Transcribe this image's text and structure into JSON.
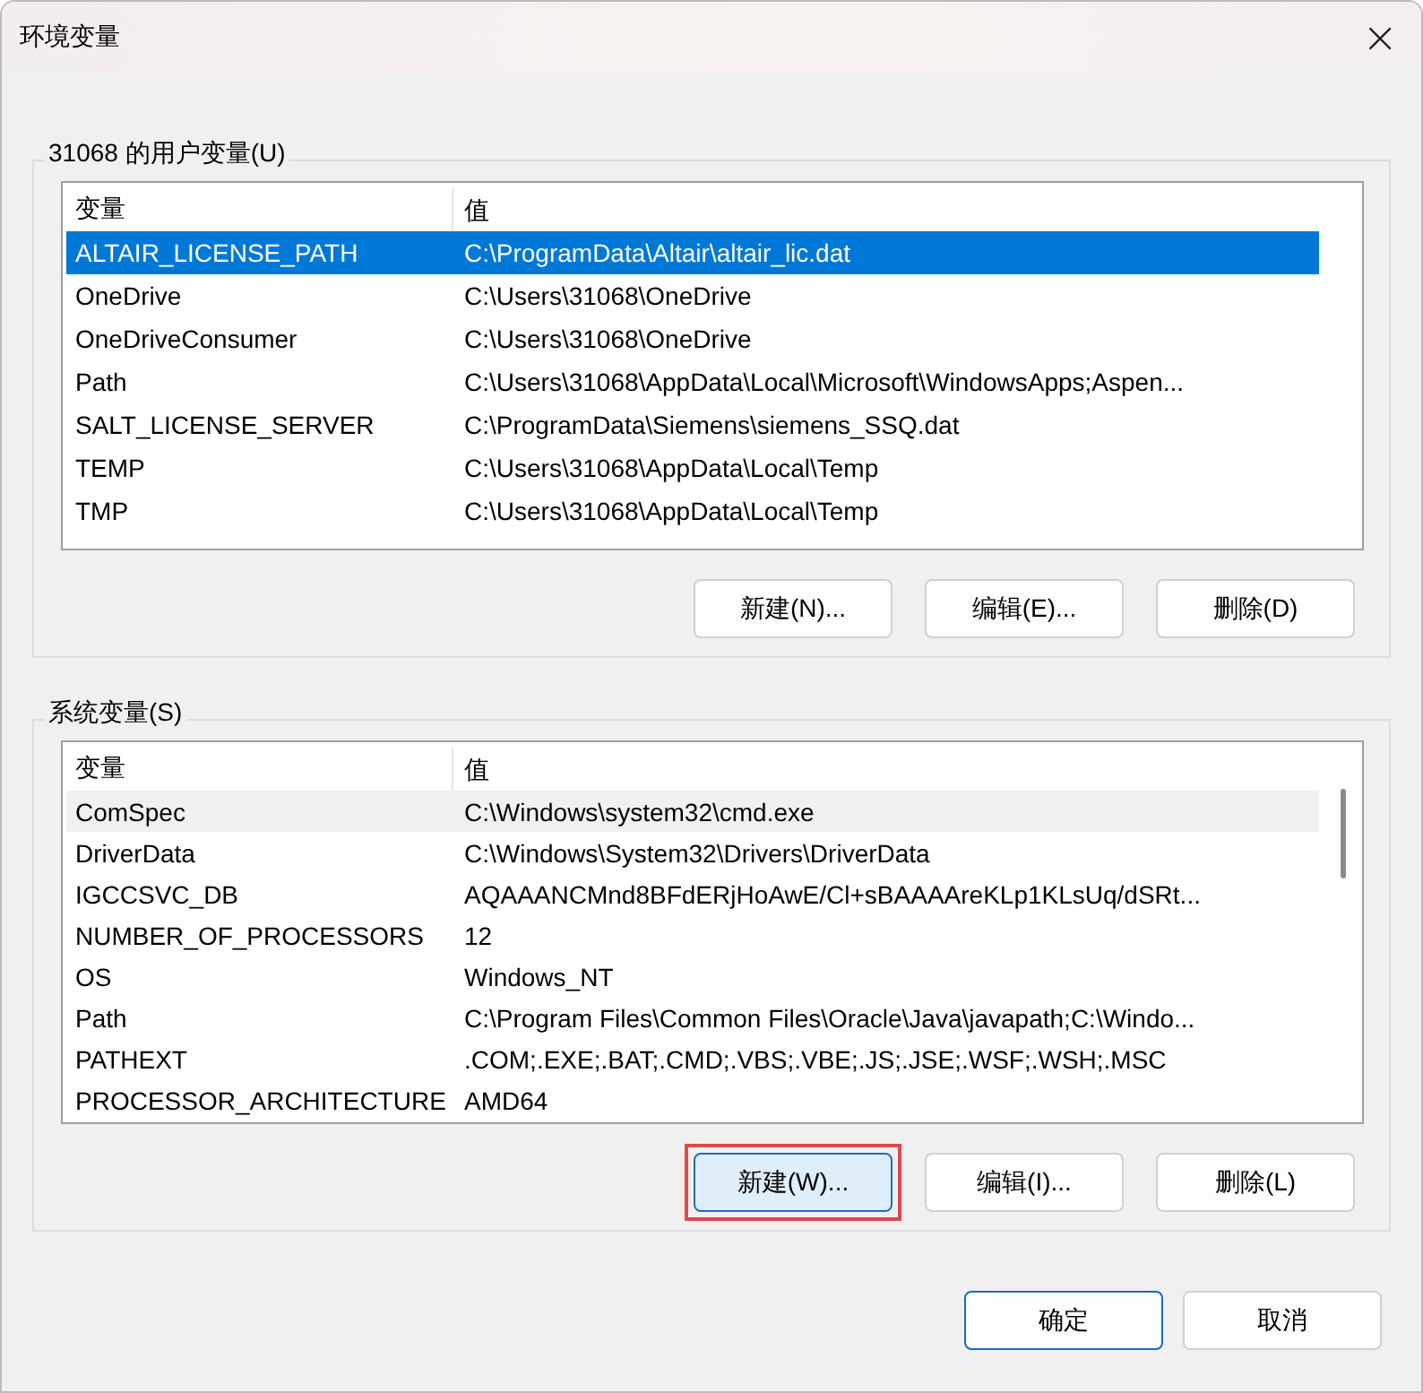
{
  "window": {
    "title": "环境变量",
    "close": "×"
  },
  "user_vars": {
    "label": "31068 的用户变量(U)",
    "focused": true,
    "columns": [
      "变量",
      "值"
    ],
    "rows": [
      {
        "name": "ALTAIR_LICENSE_PATH",
        "value": "C:\\ProgramData\\Altair\\altair_lic.dat",
        "selected": true
      },
      {
        "name": "OneDrive",
        "value": "C:\\Users\\31068\\OneDrive",
        "selected": false
      },
      {
        "name": "OneDriveConsumer",
        "value": "C:\\Users\\31068\\OneDrive",
        "selected": false
      },
      {
        "name": "Path",
        "value": "C:\\Users\\31068\\AppData\\Local\\Microsoft\\WindowsApps;Aspen...",
        "selected": false
      },
      {
        "name": "SALT_LICENSE_SERVER",
        "value": "C:\\ProgramData\\Siemens\\siemens_SSQ.dat",
        "selected": false
      },
      {
        "name": "TEMP",
        "value": "C:\\Users\\31068\\AppData\\Local\\Temp",
        "selected": false
      },
      {
        "name": "TMP",
        "value": "C:\\Users\\31068\\AppData\\Local\\Temp",
        "selected": false
      }
    ],
    "buttons": [
      {
        "label": "新建(N)...",
        "hover": false,
        "highlighted": false
      },
      {
        "label": "编辑(E)...",
        "hover": false,
        "highlighted": false
      },
      {
        "label": "删除(D)",
        "hover": false,
        "highlighted": false
      }
    ]
  },
  "system_vars": {
    "label": "系统变量(S)",
    "focused": false,
    "columns": [
      "变量",
      "值"
    ],
    "rows": [
      {
        "name": "ComSpec",
        "value": "C:\\Windows\\system32\\cmd.exe",
        "selected": true
      },
      {
        "name": "DriverData",
        "value": "C:\\Windows\\System32\\Drivers\\DriverData",
        "selected": false
      },
      {
        "name": "IGCCSVC_DB",
        "value": "AQAAANCMnd8BFdERjHoAwE/Cl+sBAAAAreKLp1KLsUq/dSRt...",
        "selected": false
      },
      {
        "name": "NUMBER_OF_PROCESSORS",
        "value": "12",
        "selected": false
      },
      {
        "name": "OS",
        "value": "Windows_NT",
        "selected": false
      },
      {
        "name": "Path",
        "value": "C:\\Program Files\\Common Files\\Oracle\\Java\\javapath;C:\\Windo...",
        "selected": false
      },
      {
        "name": "PATHEXT",
        "value": ".COM;.EXE;.BAT;.CMD;.VBS;.VBE;.JS;.JSE;.WSF;.WSH;.MSC",
        "selected": false
      },
      {
        "name": "PROCESSOR_ARCHITECTURE",
        "value": "AMD64",
        "selected": false
      }
    ],
    "buttons": [
      {
        "label": "新建(W)...",
        "hover": true,
        "highlighted": true
      },
      {
        "label": "编辑(I)...",
        "hover": false,
        "highlighted": false
      },
      {
        "label": "删除(L)",
        "hover": false,
        "highlighted": false
      }
    ]
  },
  "dialog_buttons": [
    {
      "label": "确定",
      "default": true
    },
    {
      "label": "取消",
      "default": false
    }
  ]
}
